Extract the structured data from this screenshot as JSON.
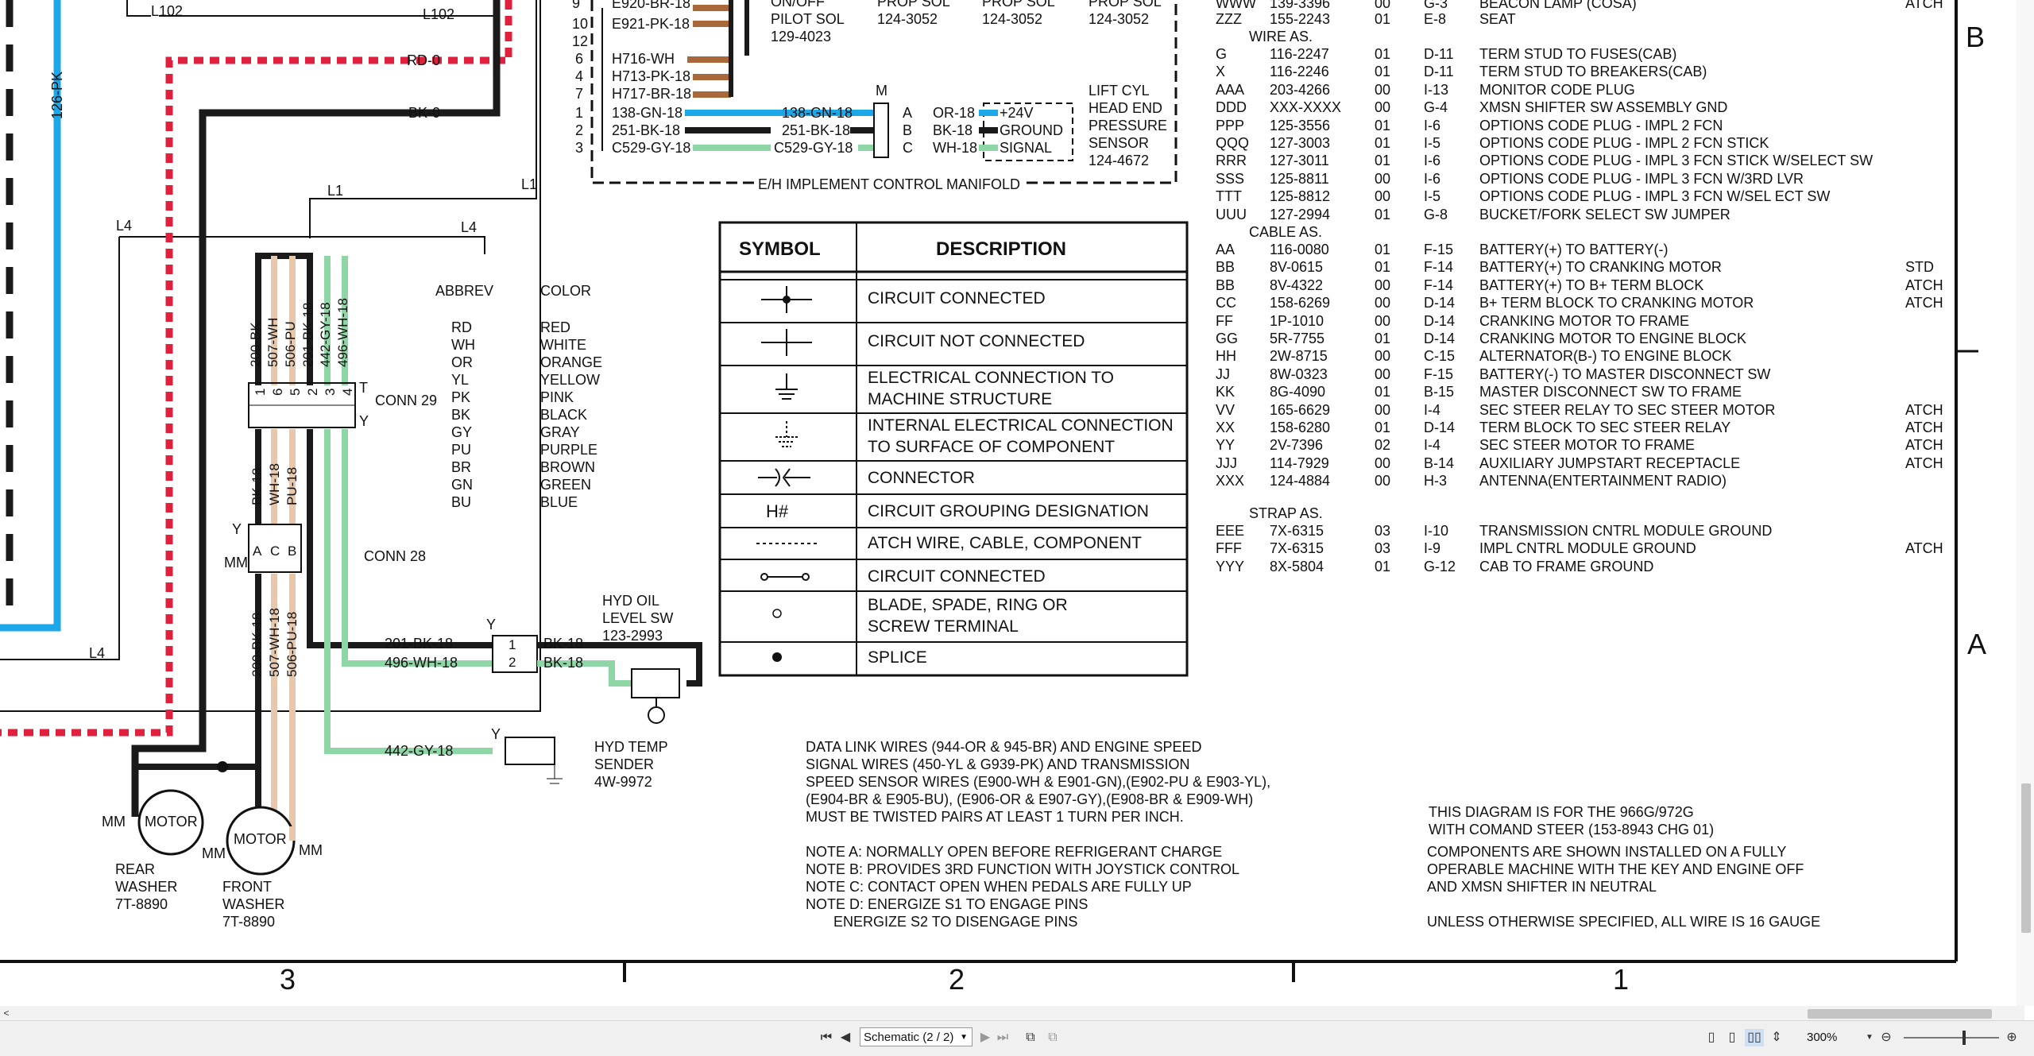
{
  "colors": {
    "black_wire": "#1a1a1a",
    "red_wire": "#e0203c",
    "blue_wire": "#1ca7e8",
    "green_wire": "#8fd6a6",
    "tan_wire": "#e8c8ac",
    "brown_wire": "#a8683a"
  },
  "zones": {
    "top_right": "B",
    "mid_right": "A",
    "bottom_3": "3",
    "bottom_2": "2",
    "bottom_1": "1"
  },
  "wires": {
    "l102_left": "L102",
    "l102_right": "L102",
    "rd0": "RD-0",
    "bk0": "BK-0",
    "pk126": "126-PK",
    "l1_a": "L1",
    "l1_b": "L1",
    "l4_a": "L4",
    "l4_b": "L4",
    "l4_c": "L4",
    "conn29_wires": [
      "200-BK",
      "507-WH",
      "506-PU",
      "201-BK-18",
      "442-GY-18",
      "496-WH-18"
    ],
    "between_wires": [
      "BK-18",
      "WH-18",
      "PU-18"
    ],
    "conn28_wires": [
      "200-BK-18",
      "507-WH-18",
      "506-PU-18"
    ],
    "w201": "201-BK-18",
    "w496": "496-WH-18",
    "w442": "442-GY-18",
    "bk18_a": "BK-18",
    "bk18_b": "BK-18"
  },
  "pilot": {
    "rows": [
      {
        "num": "9",
        "label": "E920-BR-18"
      },
      {
        "num": "10",
        "label": "E921-PK-18"
      },
      {
        "num": "12",
        "label": ""
      },
      {
        "num": "6",
        "label": "H716-WH"
      },
      {
        "num": "4",
        "label": "H713-PK-18"
      },
      {
        "num": "7",
        "label": "H717-BR-18"
      },
      {
        "num": "1",
        "label": "138-GN-18"
      },
      {
        "num": "2",
        "label": "251-BK-18"
      },
      {
        "num": "3",
        "label": "C529-GY-18"
      }
    ],
    "on_off": "ON/OFF",
    "pilot_sol": "PILOT SOL",
    "pilot_pn": "129-4023",
    "prop_sol_a": "PROP SOL",
    "prop_pn_a": "124-3052",
    "prop_sol_b": "PROP SOL",
    "prop_pn_b": "124-3052",
    "prop_sol_c": "PROP SOL",
    "prop_pn_c": "124-3052",
    "mid_wires": [
      "138-GN-18",
      "251-BK-18",
      "C529-GY-18"
    ],
    "m_label": "M",
    "abc": [
      "A",
      "B",
      "C"
    ],
    "sensor_wires": [
      "OR-18",
      "BK-18",
      "WH-18"
    ],
    "sensor_pins": [
      "+24V",
      "GROUND",
      "SIGNAL"
    ],
    "sensor_title": [
      "LIFT CYL",
      "HEAD END",
      "PRESSURE",
      "SENSOR",
      "124-4672"
    ],
    "manifold": "E/H IMPLEMENT CONTROL MANIFOLD"
  },
  "color_table": {
    "abbrev_header": "ABBREV",
    "color_header": "COLOR",
    "rows": [
      [
        "RD",
        "RED"
      ],
      [
        "WH",
        "WHITE"
      ],
      [
        "OR",
        "ORANGE"
      ],
      [
        "YL",
        "YELLOW"
      ],
      [
        "PK",
        "PINK"
      ],
      [
        "BK",
        "BLACK"
      ],
      [
        "GY",
        "GRAY"
      ],
      [
        "PU",
        "PURPLE"
      ],
      [
        "BR",
        "BROWN"
      ],
      [
        "GN",
        "GREEN"
      ],
      [
        "BU",
        "BLUE"
      ]
    ]
  },
  "connectors": {
    "conn29": "CONN 29",
    "conn28": "CONN 28",
    "t": "T",
    "y": "Y",
    "y2": "Y",
    "mm": "MM",
    "conn29_pins": [
      "1",
      "6",
      "5",
      "2",
      "3",
      "4"
    ],
    "conn28_pins": [
      "A",
      "C",
      "B"
    ],
    "yb": "Y",
    "hyd_pins": [
      "1",
      "2"
    ],
    "yc": "Y"
  },
  "hyd_oil": [
    "HYD OIL",
    "LEVEL SW",
    "123-2993"
  ],
  "hyd_temp": [
    "HYD TEMP",
    "SENDER",
    "4W-9972"
  ],
  "motors": {
    "rear": {
      "label": "MOTOR",
      "mm": "MM",
      "mm2": "MM",
      "name": [
        "REAR",
        "WASHER",
        "7T-8890"
      ]
    },
    "front": {
      "label": "MOTOR",
      "mm": "MM",
      "name": [
        "FRONT",
        "WASHER",
        "7T-8890"
      ]
    }
  },
  "legend": {
    "symbol_header": "SYMBOL",
    "desc_header": "DESCRIPTION",
    "rows": [
      {
        "icon": "circuit-connected-icon",
        "desc": "CIRCUIT CONNECTED"
      },
      {
        "icon": "circuit-not-connected-icon",
        "desc": "CIRCUIT NOT CONNECTED"
      },
      {
        "icon": "ground-icon",
        "desc": "ELECTRICAL CONNECTION TO MACHINE STRUCTURE"
      },
      {
        "icon": "internal-ground-icon",
        "desc": "INTERNAL ELECTRICAL CONNECTION TO SURFACE OF COMPONENT"
      },
      {
        "icon": "connector-icon",
        "desc": "CONNECTOR"
      },
      {
        "icon": "h-hash",
        "symbol_text": "H#",
        "desc": "CIRCUIT GROUPING DESIGNATION"
      },
      {
        "icon": "dashed-line-icon",
        "desc": "ATCH WIRE, CABLE, COMPONENT"
      },
      {
        "icon": "circuit-connected-oo-icon",
        "desc": "CIRCUIT CONNECTED"
      },
      {
        "icon": "terminal-icon",
        "desc": "BLADE, SPADE, RING OR SCREW TERMINAL"
      },
      {
        "icon": "splice-icon",
        "desc": "SPLICE"
      }
    ]
  },
  "parts": {
    "top_rows": [
      {
        "id": "WWW",
        "pn": "139-3396",
        "qty": "00",
        "loc": "G-3",
        "desc": "BEACON LAMP (COSA)",
        "note": "ATCH"
      },
      {
        "id": "ZZZ",
        "pn": "155-2243",
        "qty": "01",
        "loc": "E-8",
        "desc": "SEAT",
        "note": ""
      }
    ],
    "wire_header": "WIRE AS.",
    "wire_rows": [
      {
        "id": "G",
        "pn": "116-2247",
        "qty": "01",
        "loc": "D-11",
        "desc": "TERM STUD TO FUSES(CAB)",
        "note": ""
      },
      {
        "id": "X",
        "pn": "116-2246",
        "qty": "01",
        "loc": "D-11",
        "desc": "TERM STUD TO BREAKERS(CAB)",
        "note": ""
      },
      {
        "id": "AAA",
        "pn": "203-4266",
        "qty": "00",
        "loc": "I-13",
        "desc": "MONITOR CODE PLUG",
        "note": ""
      },
      {
        "id": "DDD",
        "pn": "XXX-XXXX",
        "qty": "00",
        "loc": "G-4",
        "desc": "XMSN SHIFTER SW ASSEMBLY GND",
        "note": ""
      },
      {
        "id": "PPP",
        "pn": "125-3556",
        "qty": "01",
        "loc": "I-6",
        "desc": "OPTIONS CODE PLUG - IMPL 2 FCN",
        "note": ""
      },
      {
        "id": "QQQ",
        "pn": "127-3003",
        "qty": "01",
        "loc": "I-5",
        "desc": "OPTIONS CODE PLUG - IMPL 2 FCN STICK",
        "note": ""
      },
      {
        "id": "RRR",
        "pn": "127-3011",
        "qty": "01",
        "loc": "I-6",
        "desc": "OPTIONS CODE PLUG - IMPL 3 FCN STICK  W/SELECT SW",
        "note": ""
      },
      {
        "id": "SSS",
        "pn": "125-8811",
        "qty": "00",
        "loc": "I-6",
        "desc": "OPTIONS CODE PLUG - IMPL 3 FCN W/3RD LVR",
        "note": ""
      },
      {
        "id": "TTT",
        "pn": "125-8812",
        "qty": "00",
        "loc": "I-5",
        "desc": "OPTIONS CODE PLUG - IMPL 3 FCN W/SEL ECT SW",
        "note": ""
      },
      {
        "id": "UUU",
        "pn": "127-2994",
        "qty": "01",
        "loc": "G-8",
        "desc": "BUCKET/FORK SELECT SW JUMPER",
        "note": ""
      }
    ],
    "cable_header": "CABLE AS.",
    "cable_rows": [
      {
        "id": "AA",
        "pn": "116-0080",
        "qty": "01",
        "loc": "F-15",
        "desc": "BATTERY(+) TO BATTERY(-)",
        "note": ""
      },
      {
        "id": "BB",
        "pn": "8V-0615",
        "qty": "01",
        "loc": "F-14",
        "desc": "BATTERY(+) TO CRANKING MOTOR",
        "note": "STD"
      },
      {
        "id": "BB",
        "pn": "8V-4322",
        "qty": "00",
        "loc": "F-14",
        "desc": "BATTERY(+) TO B+ TERM BLOCK",
        "note": "ATCH"
      },
      {
        "id": "CC",
        "pn": "158-6269",
        "qty": "00",
        "loc": "D-14",
        "desc": "B+ TERM BLOCK TO CRANKING MOTOR",
        "note": "ATCH"
      },
      {
        "id": "FF",
        "pn": "1P-1010",
        "qty": "00",
        "loc": "D-14",
        "desc": "CRANKING MOTOR TO FRAME",
        "note": ""
      },
      {
        "id": "GG",
        "pn": "5R-7755",
        "qty": "01",
        "loc": "D-14",
        "desc": "CRANKING MOTOR TO ENGINE BLOCK",
        "note": ""
      },
      {
        "id": "HH",
        "pn": "2W-8715",
        "qty": "00",
        "loc": "C-15",
        "desc": "ALTERNATOR(B-) TO ENGINE BLOCK",
        "note": ""
      },
      {
        "id": "JJ",
        "pn": "8W-0323",
        "qty": "00",
        "loc": "F-15",
        "desc": "BATTERY(-) TO MASTER DISCONNECT SW",
        "note": ""
      },
      {
        "id": "KK",
        "pn": "8G-4090",
        "qty": "01",
        "loc": "B-15",
        "desc": "MASTER DISCONNECT SW TO FRAME",
        "note": ""
      },
      {
        "id": "VV",
        "pn": "165-6629",
        "qty": "00",
        "loc": "I-4",
        "desc": "SEC STEER RELAY TO SEC STEER MOTOR",
        "note": "ATCH"
      },
      {
        "id": "XX",
        "pn": "158-6280",
        "qty": "01",
        "loc": "D-14",
        "desc": "TERM BLOCK TO SEC STEER RELAY",
        "note": "ATCH"
      },
      {
        "id": "YY",
        "pn": "2V-7396",
        "qty": "02",
        "loc": "I-4",
        "desc": "SEC STEER MOTOR TO FRAME",
        "note": "ATCH"
      },
      {
        "id": "JJJ",
        "pn": "114-7929",
        "qty": "00",
        "loc": "B-14",
        "desc": "AUXILIARY JUMPSTART RECEPTACLE",
        "note": "ATCH"
      },
      {
        "id": "XXX",
        "pn": "124-4884",
        "qty": "00",
        "loc": "H-3",
        "desc": "ANTENNA(ENTERTAINMENT RADIO)",
        "note": ""
      }
    ],
    "strap_header": "STRAP AS.",
    "strap_rows": [
      {
        "id": "EEE",
        "pn": "7X-6315",
        "qty": "03",
        "loc": "I-10",
        "desc": "TRANSMISSION CNTRL MODULE GROUND",
        "note": ""
      },
      {
        "id": "FFF",
        "pn": "7X-6315",
        "qty": "03",
        "loc": "I-9",
        "desc": "IMPL CNTRL MODULE GROUND",
        "note": "ATCH"
      },
      {
        "id": "YYY",
        "pn": "8X-5804",
        "qty": "01",
        "loc": "G-12",
        "desc": "CAB TO FRAME GROUND",
        "note": ""
      }
    ]
  },
  "notes": {
    "data_link": [
      "DATA LINK WIRES (944-OR & 945-BR) AND ENGINE SPEED",
      "SIGNAL WIRES (450-YL & G939-PK) AND TRANSMISSION",
      "SPEED SENSOR WIRES (E900-WH & E901-GN),(E902-PU & E903-YL),",
      "(E904-BR & E905-BU), (E906-OR & E907-GY),(E908-BR & E909-WH)",
      "MUST BE TWISTED PAIRS AT LEAST 1 TURN PER INCH."
    ],
    "lettered": [
      "NOTE A: NORMALLY OPEN BEFORE REFRIGERANT CHARGE",
      "NOTE B: PROVIDES 3RD FUNCTION WITH JOYSTICK CONTROL",
      "NOTE C: CONTACT OPEN WHEN PEDALS ARE  FULLY UP",
      "NOTE D: ENERGIZE S1 TO ENGAGE PINS",
      "       ENERGIZE S2 TO DISENGAGE PINS"
    ],
    "diagram": [
      "THIS DIAGRAM IS FOR THE 966G/972G",
      "WITH COMAND STEER (153-8943  CHG 01)",
      "COMPONENTS ARE SHOWN INSTALLED ON A FULLY",
      "OPERABLE MACHINE WITH THE KEY AND ENGINE OFF",
      "AND XMSN SHIFTER IN NEUTRAL",
      "UNLESS OTHERWISE SPECIFIED, ALL WIRE  IS 16 GAUGE"
    ]
  },
  "viewer": {
    "page_select": "Schematic (2 / 2)",
    "zoom": "300%"
  }
}
